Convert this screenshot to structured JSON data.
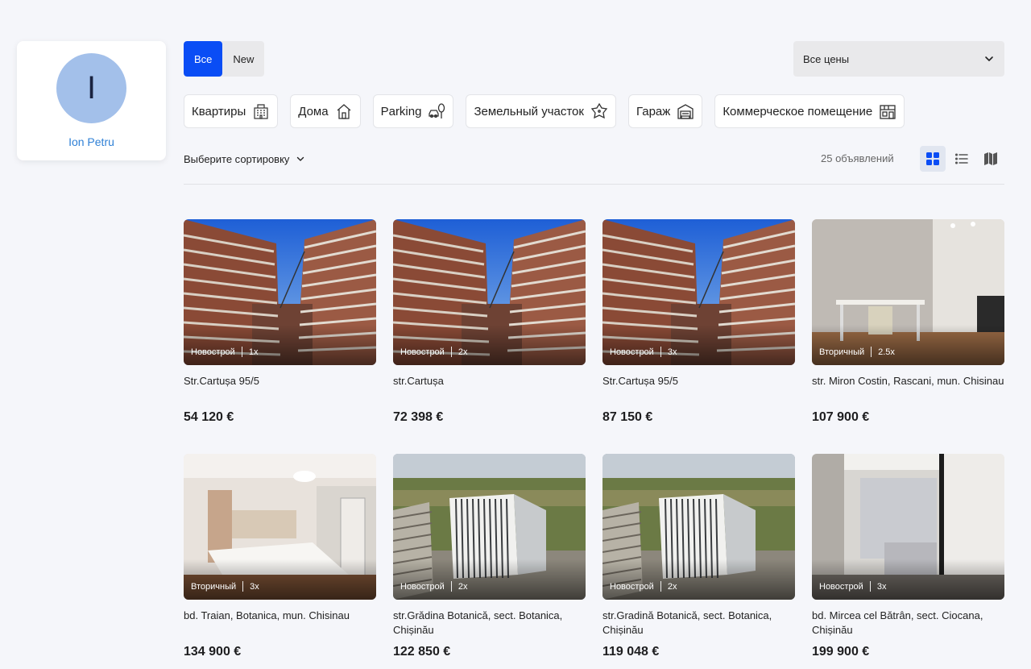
{
  "profile": {
    "initial": "I",
    "name": "Ion Petru"
  },
  "filter_tabs": [
    {
      "label": "Все",
      "active": true
    },
    {
      "label": "New",
      "active": false
    }
  ],
  "price_select": {
    "value": "Все цены"
  },
  "categories": [
    {
      "label": "Квартиры",
      "icon": "apartment-building-icon"
    },
    {
      "label": "Дома",
      "icon": "house-icon"
    },
    {
      "label": "Parking",
      "icon": "parking-car-tree-icon"
    },
    {
      "label": "Земельный участок",
      "icon": "land-plot-icon"
    },
    {
      "label": "Гараж",
      "icon": "garage-icon"
    },
    {
      "label": "Коммерческое помещение",
      "icon": "commercial-space-icon"
    }
  ],
  "sort": {
    "label": "Выберите сортировку"
  },
  "results": {
    "count_text": "25 объявлений"
  },
  "view_modes": [
    {
      "name": "grid-view",
      "icon": "grid-icon",
      "active": true
    },
    {
      "name": "list-view",
      "icon": "list-icon",
      "active": false
    },
    {
      "name": "map-view",
      "icon": "map-icon",
      "active": false
    }
  ],
  "listings": [
    {
      "type": "Новострой",
      "rooms": "1x",
      "address": "Str.Cartușa 95/5",
      "price": "54 120 €",
      "image": "construction"
    },
    {
      "type": "Новострой",
      "rooms": "2x",
      "address": "str.Cartușa",
      "price": "72 398 €",
      "image": "construction"
    },
    {
      "type": "Новострой",
      "rooms": "3x",
      "address": "Str.Cartușa 95/5",
      "price": "87 150 €",
      "image": "construction"
    },
    {
      "type": "Вторичный",
      "rooms": "2.5x",
      "address": "str. Miron Costin, Rascani, mun. Chisinau",
      "price": "107 900 €",
      "image": "interior-kitchen"
    },
    {
      "type": "Вторичный",
      "rooms": "3x",
      "address": "bd. Traian, Botanica, mun. Chisinau",
      "price": "134 900 €",
      "image": "bedroom"
    },
    {
      "type": "Новострой",
      "rooms": "2x",
      "address": "str.Grădina Botanică, sect. Botanica, Chișinău",
      "price": "122 850 €",
      "image": "aerial-tower"
    },
    {
      "type": "Новострой",
      "rooms": "2x",
      "address": "str.Gradină Botanică, sect. Botanica, Chișinău",
      "price": "119 048 €",
      "image": "aerial-tower"
    },
    {
      "type": "Новострой",
      "rooms": "3x",
      "address": "bd. Mircea cel Bătrân, sect. Ciocana, Chișinău",
      "price": "199 900 €",
      "image": "bedroom-narrow"
    }
  ],
  "colors": {
    "accent": "#0a4df5",
    "link": "#2f80d6",
    "avatar": "#a3c0ea"
  }
}
